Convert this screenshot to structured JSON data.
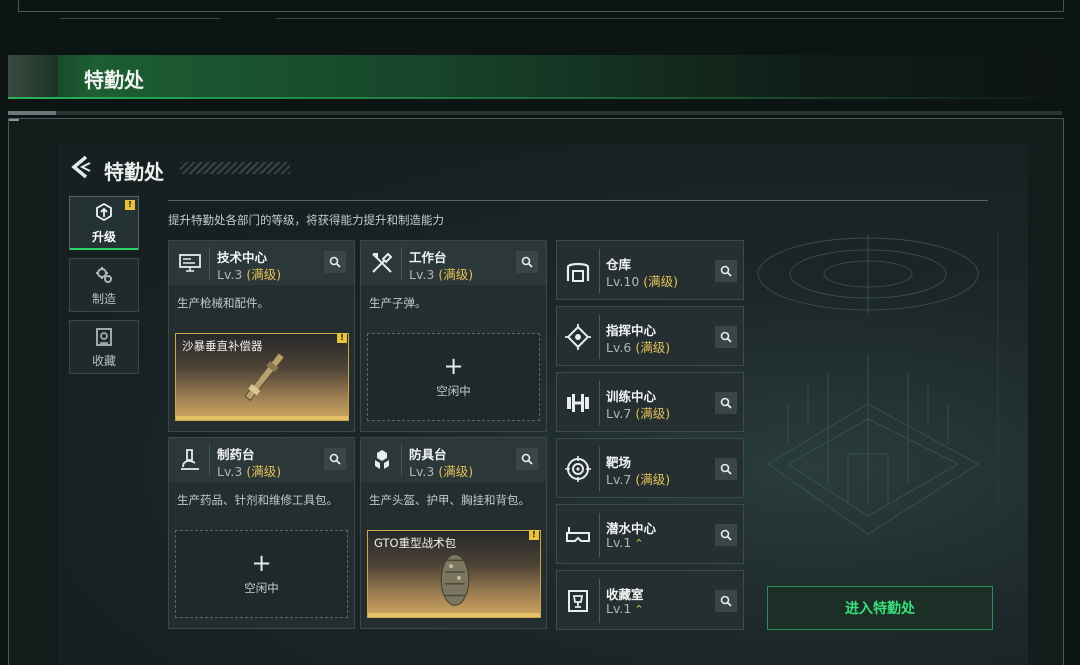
{
  "banner": {
    "title": "特勤处"
  },
  "screen": {
    "title": "特勤处"
  },
  "sidebar": {
    "tabs": [
      {
        "label": "升级",
        "icon": "upgrade-icon",
        "active": true,
        "badge": "!"
      },
      {
        "label": "制造",
        "icon": "gears-icon",
        "active": false
      },
      {
        "label": "收藏",
        "icon": "collection-icon",
        "active": false
      }
    ]
  },
  "description": "提升特勤处各部门的等级，将获得能力提升和制造能力",
  "departments": [
    {
      "name": "技术中心",
      "level": "Lv.3",
      "status": "(满级)",
      "icon": "monitor-icon",
      "desc": "生产枪械和配件。",
      "slot": {
        "type": "item",
        "name": "沙暴垂直补偿器",
        "badge": "!"
      }
    },
    {
      "name": "工作台",
      "level": "Lv.3",
      "status": "(满级)",
      "icon": "tools-icon",
      "desc": "生产子弹。",
      "slot": {
        "type": "empty",
        "plus": "+",
        "label": "空闲中"
      }
    },
    {
      "name": "制药台",
      "level": "Lv.3",
      "status": "(满级)",
      "icon": "microscope-icon",
      "desc": "生产药品、针剂和维修工具包。",
      "slot": {
        "type": "empty",
        "plus": "+",
        "label": "空闲中"
      }
    },
    {
      "name": "防具台",
      "level": "Lv.3",
      "status": "(满级)",
      "icon": "armor-icon",
      "desc": "生产头盔、护甲、胸挂和背包。",
      "slot": {
        "type": "item",
        "name": "GTO重型战术包",
        "badge": "!"
      }
    }
  ],
  "facilities": [
    {
      "name": "仓库",
      "level": "Lv.10",
      "status": "(满级)",
      "icon": "warehouse-icon"
    },
    {
      "name": "指挥中心",
      "level": "Lv.6",
      "status": "(满级)",
      "icon": "chip-icon"
    },
    {
      "name": "训练中心",
      "level": "Lv.7",
      "status": "(满级)",
      "icon": "dumbbell-icon"
    },
    {
      "name": "靶场",
      "level": "Lv.7",
      "status": "(满级)",
      "icon": "target-icon"
    },
    {
      "name": "潜水中心",
      "level": "Lv.1",
      "status": "",
      "upgradeable": true,
      "icon": "diving-mask-icon"
    },
    {
      "name": "收藏室",
      "level": "Lv.1",
      "status": "",
      "upgradeable": true,
      "icon": "trophy-icon"
    }
  ],
  "enter_button": {
    "label": "进入特勤处"
  },
  "colors": {
    "accent_green": "#39e07a",
    "maxed_gold": "#e3c15a",
    "slot_border_gold": "#c9a646"
  }
}
